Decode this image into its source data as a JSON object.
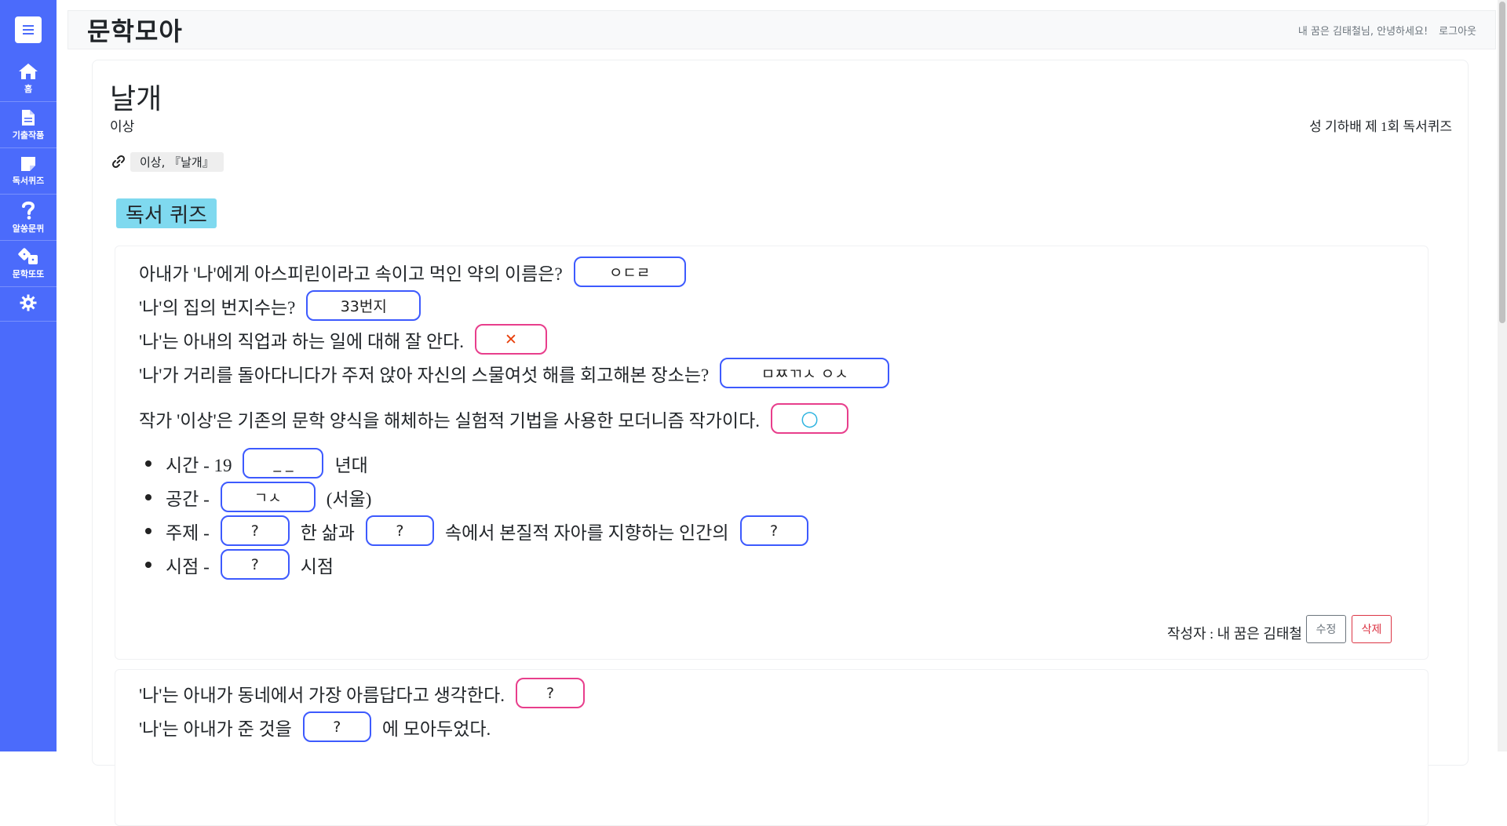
{
  "sidebar": {
    "items": [
      {
        "icon": "home-icon",
        "label": "홈"
      },
      {
        "icon": "document-icon",
        "label": "기출작품"
      },
      {
        "icon": "note-icon",
        "label": "독서퀴즈"
      },
      {
        "icon": "question-icon",
        "label": "알쏭문퀴"
      },
      {
        "icon": "dice-icon",
        "label": "문학또또"
      }
    ],
    "settings_icon": "gear-icon"
  },
  "header": {
    "brand": "문학모아",
    "greeting": "내 꿈은 김태철님, 안녕하세요!",
    "logout": "로그아웃"
  },
  "work": {
    "title": "날개",
    "author": "이상",
    "quiz_source": "성 기하배 제 1회 독서퀴즈",
    "reference": "이상, 『날개』"
  },
  "section_title": "독서 퀴즈",
  "quiz1": {
    "q1": {
      "text": "아내가 '나'에게 아스피린이라고 속이고 먹인 약의 이름은?",
      "answer": "ㅇㄷㄹ"
    },
    "q2": {
      "text": "'나'의 집의 번지수는?",
      "answer": "33번지"
    },
    "q3": {
      "text": "'나'는 아내의 직업과 하는 일에 대해 잘 안다.",
      "answer": "✕"
    },
    "q4": {
      "text": "'나'가 거리를 돌아다니다가 주저 앉아 자신의 스물여섯 해를 회고해본 장소는?",
      "answer": "ㅁㅉㄲㅅ ㅇㅅ"
    },
    "q5": {
      "text": "작가 '이상'은 기존의 문학 양식을 해체하는 실험적 기법을 사용한 모더니즘 작가이다.",
      "answer": "○"
    },
    "bullets": {
      "time": {
        "prefix": "시간 - 19",
        "answer": "_ _",
        "suffix": "년대"
      },
      "space": {
        "prefix": "공간 -",
        "answer": "ㄱㅅ",
        "suffix": "(서울)"
      },
      "theme": {
        "prefix": "주제 -",
        "a1": "?",
        "mid1": "한 삶과",
        "a2": "?",
        "mid2": "속에서 본질적 자아를 지향하는 인간의",
        "a3": "?"
      },
      "pov": {
        "prefix": "시점 -",
        "answer": "?",
        "suffix": "시점"
      }
    },
    "writer": "작성자 : 내 꿈은 김태철",
    "edit": "수정",
    "delete": "삭제"
  },
  "quiz2": {
    "q1": {
      "text": "'나'는 아내가 동네에서 가장 아름답다고 생각한다.",
      "answer": "?"
    },
    "q2": {
      "prefix": "'나'는 아내가 준 것을",
      "answer": "?",
      "suffix": "에 모아두었다."
    }
  },
  "colors": {
    "sidebar": "#4b6bfb",
    "answer_border": "#3d5afe",
    "ox_border": "#e83e8c",
    "section_bg": "#7fd9ef",
    "delete": "#dc3545"
  }
}
